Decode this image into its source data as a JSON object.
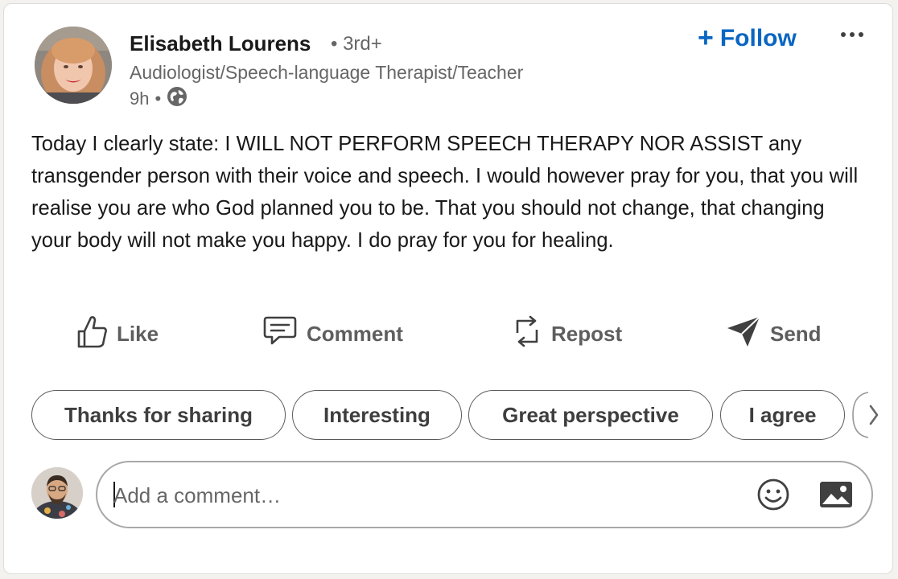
{
  "post": {
    "author": {
      "name": "Elisabeth Lourens",
      "degree": "• 3rd+",
      "headline": "Audiologist/Speech-language Therapist/Teacher",
      "time": "9h",
      "separator": "•",
      "visibility_icon": "globe-icon"
    },
    "follow_label": "Follow",
    "more_icon": "more-options-icon",
    "body": "Today I clearly state: I WILL NOT PERFORM SPEECH THERAPY NOR ASSIST any transgender person with their voice and speech. I would however pray for you, that you will realise you are who God planned you to be. That you should not change, that changing your body will not make you happy. I do pray for you for healing."
  },
  "actions": [
    {
      "label": "Like",
      "icon": "thumbs-up-icon"
    },
    {
      "label": "Comment",
      "icon": "comment-icon"
    },
    {
      "label": "Repost",
      "icon": "repost-icon"
    },
    {
      "label": "Send",
      "icon": "send-icon"
    }
  ],
  "suggested_replies": [
    "Thanks for sharing",
    "Interesting",
    "Great perspective",
    "I agree"
  ],
  "comment": {
    "placeholder": "Add a comment…",
    "emoji_icon": "emoji-icon",
    "image_icon": "image-icon"
  },
  "colors": {
    "accent": "#0a66c2",
    "text": "#191919",
    "muted": "#666666",
    "background": "#f3f2ef"
  }
}
